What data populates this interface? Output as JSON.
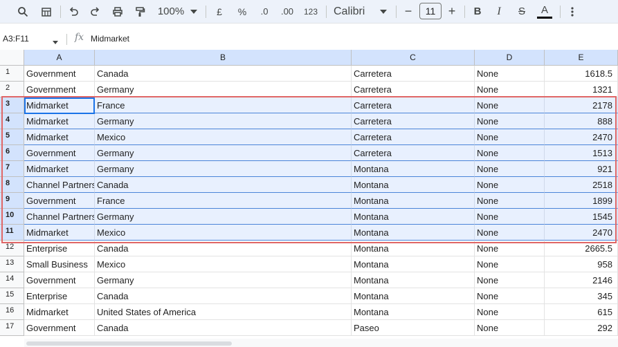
{
  "toolbar": {
    "zoom": "100%",
    "currency_label": "£",
    "percent_label": "%",
    "dec_decrease_label": ".0",
    "dec_increase_label": ".00",
    "format_label": "123",
    "font_name": "Calibri",
    "font_size": "11",
    "minus_label": "−",
    "plus_label": "+",
    "bold_label": "B",
    "italic_label": "I",
    "strike_label": "S",
    "textcolor_label": "A",
    "textcolor_bar": "#000000"
  },
  "formula_bar": {
    "name_box": "A3:F11",
    "fx": "fx",
    "value": "Midmarket"
  },
  "columns": [
    "A",
    "B",
    "C",
    "D",
    "E"
  ],
  "rows": [
    {
      "num": "1",
      "a": "Government",
      "b": "Canada",
      "c": "Carretera",
      "d": "None",
      "e": "1618.5"
    },
    {
      "num": "2",
      "a": "Government",
      "b": "Germany",
      "c": "Carretera",
      "d": "None",
      "e": "1321"
    },
    {
      "num": "3",
      "a": "Midmarket",
      "b": "France",
      "c": "Carretera",
      "d": "None",
      "e": "2178"
    },
    {
      "num": "4",
      "a": "Midmarket",
      "b": "Germany",
      "c": "Carretera",
      "d": "None",
      "e": "888"
    },
    {
      "num": "5",
      "a": "Midmarket",
      "b": "Mexico",
      "c": "Carretera",
      "d": "None",
      "e": "2470"
    },
    {
      "num": "6",
      "a": "Government",
      "b": "Germany",
      "c": "Carretera",
      "d": "None",
      "e": "1513"
    },
    {
      "num": "7",
      "a": "Midmarket",
      "b": "Germany",
      "c": "Montana",
      "d": "None",
      "e": "921"
    },
    {
      "num": "8",
      "a": "Channel Partners",
      "b": "Canada",
      "c": "Montana",
      "d": "None",
      "e": "2518"
    },
    {
      "num": "9",
      "a": "Government",
      "b": "France",
      "c": "Montana",
      "d": "None",
      "e": "1899"
    },
    {
      "num": "10",
      "a": "Channel Partners",
      "b": "Germany",
      "c": "Montana",
      "d": "None",
      "e": "1545"
    },
    {
      "num": "11",
      "a": "Midmarket",
      "b": "Mexico",
      "c": "Montana",
      "d": "None",
      "e": "2470"
    },
    {
      "num": "12",
      "a": "Enterprise",
      "b": "Canada",
      "c": "Montana",
      "d": "None",
      "e": "2665.5"
    },
    {
      "num": "13",
      "a": "Small Business",
      "b": "Mexico",
      "c": "Montana",
      "d": "None",
      "e": "958"
    },
    {
      "num": "14",
      "a": "Government",
      "b": "Germany",
      "c": "Montana",
      "d": "None",
      "e": "2146"
    },
    {
      "num": "15",
      "a": "Enterprise",
      "b": "Canada",
      "c": "Montana",
      "d": "None",
      "e": "345"
    },
    {
      "num": "16",
      "a": "Midmarket",
      "b": "United States of America",
      "c": "Montana",
      "d": "None",
      "e": "615"
    },
    {
      "num": "17",
      "a": "Government",
      "b": "Canada",
      "c": "Paseo",
      "d": "None",
      "e": "292"
    }
  ]
}
